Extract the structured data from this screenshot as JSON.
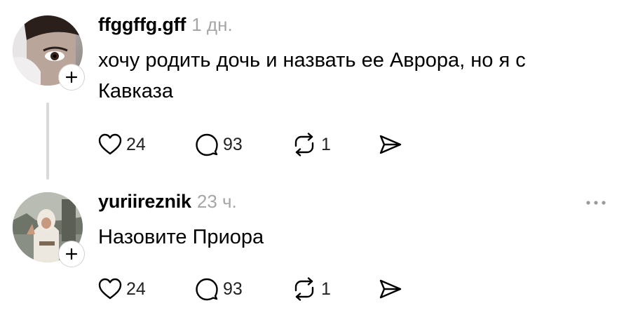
{
  "posts": [
    {
      "username": "ffggffg.gff",
      "time": "1 дн.",
      "text": "хочу родить дочь и назвать ее Аврора, но я с Кавказа",
      "likes": "24",
      "comments": "93",
      "reposts": "1"
    },
    {
      "username": "yuriireznik",
      "time": "23 ч.",
      "text": "Назовите Приора",
      "likes": "24",
      "comments": "93",
      "reposts": "1"
    }
  ],
  "icons": {
    "follow": "plus-icon",
    "like": "heart-icon",
    "comment": "speech-bubble-icon",
    "repost": "repost-icon",
    "share": "send-icon",
    "more": "more-dots-icon"
  },
  "colors": {
    "background": "#ffffff",
    "text": "#000000",
    "secondary_text": "#a6a6a6",
    "thread_line": "#d9d9d9"
  }
}
